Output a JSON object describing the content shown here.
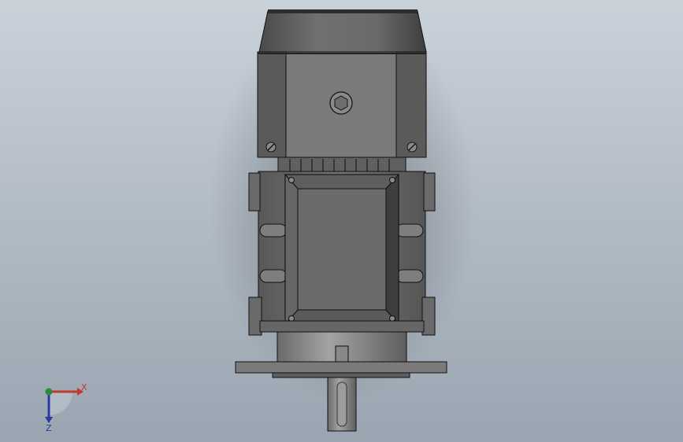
{
  "viewport": {
    "background_top": "#c9d1d9",
    "background_bottom": "#9aa5b1"
  },
  "model": {
    "body_color": "#6f6f6f",
    "dark_color": "#3a3a3a",
    "light_color": "#8c8c8c",
    "edge_color": "#111111"
  },
  "triad": {
    "x_label": "X",
    "z_label": "Z",
    "x_color": "#c0392b",
    "y_color": "#2e8b3a",
    "z_color": "#2b3a9c"
  }
}
